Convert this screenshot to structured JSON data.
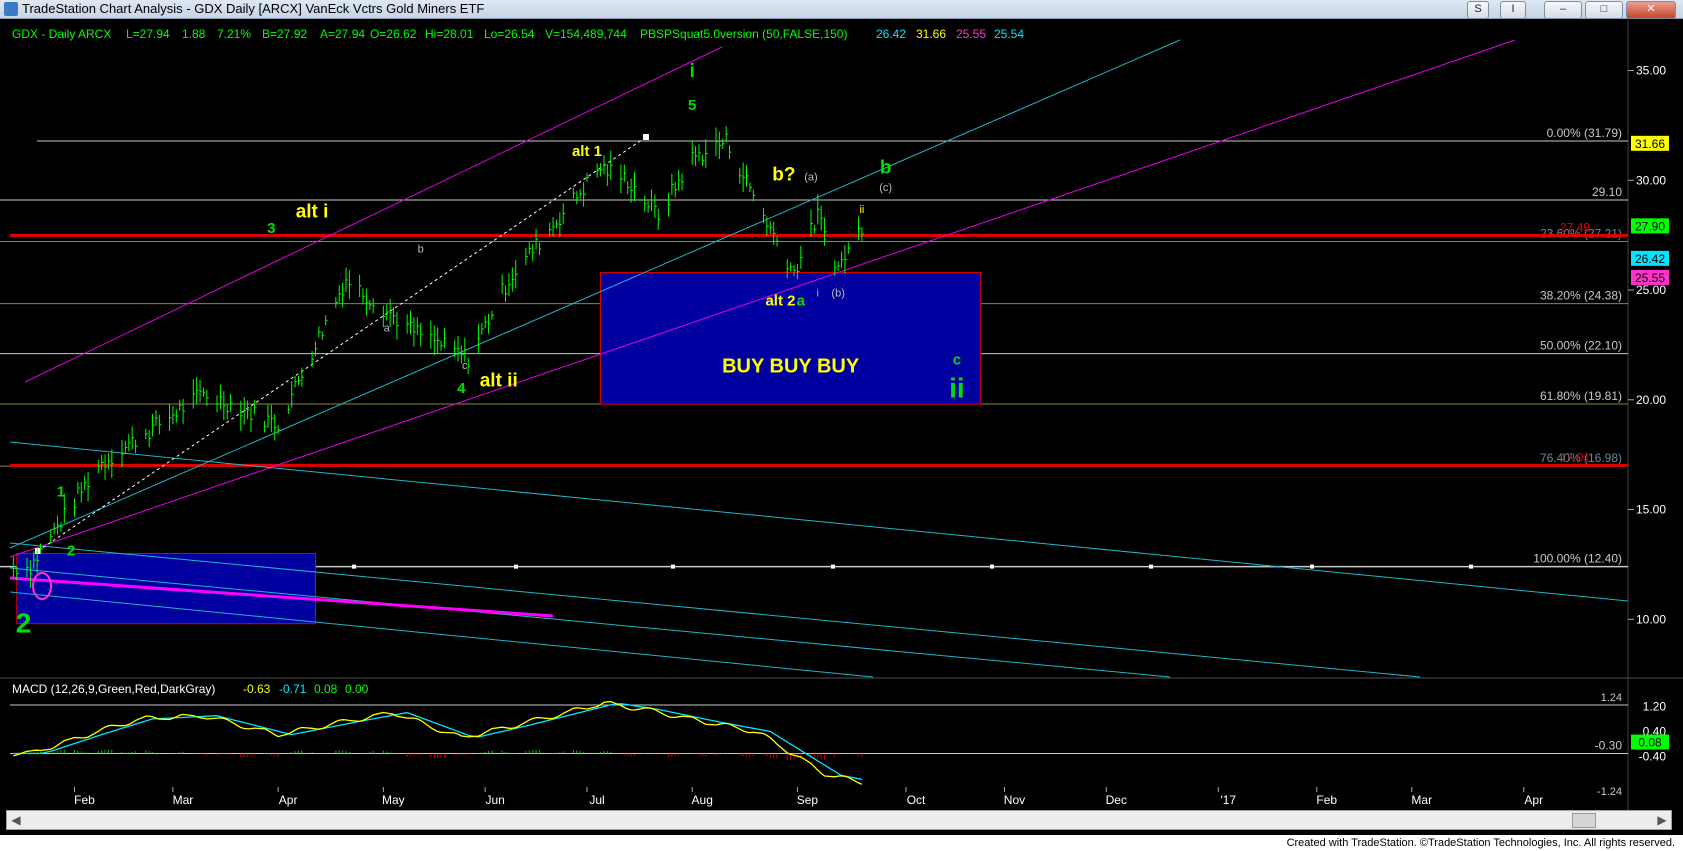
{
  "window": {
    "title": "TradeStation Chart Analysis - GDX Daily [ARCX] VanEck Vctrs Gold Miners ETF",
    "buttons": [
      "S",
      "I",
      "–",
      "□",
      "✕"
    ]
  },
  "credit": "Created with TradeStation. ©TradeStation Technologies, Inc. All rights reserved.",
  "header": {
    "symbol": "GDX - Daily  ARCX",
    "last": "L=27.94",
    "change": "1.88",
    "change_pct": "7.21%",
    "bid": "B=27.92",
    "ask": "A=27.94",
    "open": "O=26.62",
    "high": "Hi=28.01",
    "low": "Lo=26.54",
    "volume": "V=154,489,744",
    "study": "PBSPSquat5.0version (50,FALSE,150)",
    "study_values": [
      "26.42",
      "31.66",
      "25.55",
      "25.54"
    ],
    "study_colors": [
      "#00e5ff",
      "#ffff00",
      "#ff33cc",
      "#00e5ff"
    ]
  },
  "macd_header": {
    "label": "MACD (12,26,9,Green,Red,DarkGray)",
    "values": [
      "-0.63",
      "-0.71",
      "0.08",
      "0.00"
    ],
    "colors": [
      "#ffff00",
      "#00e5ff",
      "#00ff00",
      "#00ff00"
    ]
  },
  "colors": {
    "background": "#000000",
    "price_bars": "#00ff00",
    "channel_magenta": "#e000e0",
    "channel_cyan": "#1fb5c9",
    "resistance_red": "#e00000",
    "buy_box": "#0000a0",
    "fib_line": "#c0c0c0",
    "wave_green": "#00dd00",
    "wave_yellow": "#ffff00"
  },
  "chart_data": [
    {
      "type": "line",
      "title": "GDX - Daily ARCX",
      "xlabel": "",
      "ylabel": "",
      "x_ticks": [
        "Feb",
        "Mar",
        "Apr",
        "May",
        "Jun",
        "Jul",
        "Aug",
        "Sep",
        "Oct",
        "Nov",
        "Dec",
        "'17",
        "Feb",
        "Mar",
        "Apr"
      ],
      "y_ticks": [
        "10.00",
        "15.00",
        "20.00",
        "25.00",
        "30.00",
        "35.00"
      ],
      "ylim": [
        7.6,
        37.3
      ],
      "price_anchors": {
        "x": [
          "2016-01-19",
          "2016-02-08",
          "2016-03-10",
          "2016-04-01",
          "2016-04-21",
          "2016-05-10",
          "2016-05-27",
          "2016-06-08",
          "2016-07-05",
          "2016-07-13",
          "2016-07-22",
          "2016-08-01",
          "2016-08-11",
          "2016-08-24",
          "2016-08-31",
          "2016-09-07",
          "2016-09-13",
          "2016-09-20"
        ],
        "y": [
          12.4,
          17.0,
          20.3,
          18.9,
          25.5,
          23.2,
          21.9,
          25.5,
          30.6,
          30.0,
          28.4,
          31.0,
          31.79,
          27.8,
          25.8,
          28.4,
          26.0,
          27.94
        ]
      },
      "fib_levels": [
        {
          "label": "0.00% (31.79)",
          "value": 31.79
        },
        {
          "label": "29.10",
          "value": 29.1
        },
        {
          "label": "23.60% (27.21)",
          "value": 27.21
        },
        {
          "label": "38.20% (24.38)",
          "value": 24.38
        },
        {
          "label": "50.00% (22.10)",
          "value": 22.1
        },
        {
          "label": "61.80% (19.81)",
          "value": 19.81
        },
        {
          "label": "76.40% (16.98)",
          "value": 16.98
        },
        {
          "label": "100.00% (12.40)",
          "value": 12.4
        }
      ],
      "red_levels": [
        {
          "label": "27.49",
          "value": 27.49
        },
        {
          "label": "17.01",
          "value": 17.01
        }
      ],
      "price_badges": [
        {
          "label": "31.66",
          "value": 31.66,
          "color": "#ffff00"
        },
        {
          "label": "27.90",
          "value": 27.9,
          "color": "#00ff00"
        },
        {
          "label": "26.42",
          "value": 26.42,
          "color": "#00e5ff"
        },
        {
          "label": "25.55",
          "value": 25.55,
          "color": "#ff33cc"
        }
      ],
      "buy_box": {
        "label": "BUY  BUY  BUY",
        "x": [
          "2016-07-05",
          "2016-10-25"
        ],
        "y": [
          19.8,
          25.8
        ]
      },
      "wave_labels": [
        {
          "text": "i",
          "color": "#00dd00",
          "x": "2016-08-01",
          "y": 34.7,
          "size": "large"
        },
        {
          "text": "5",
          "color": "#00dd00",
          "x": "2016-08-01",
          "y": 33.2,
          "size": "medium"
        },
        {
          "text": "alt 1",
          "color": "#ffff00",
          "x": "2016-07-01",
          "y": 31.1,
          "size": "medium"
        },
        {
          "text": "b?",
          "color": "#ffff00",
          "x": "2016-08-28",
          "y": 30.0,
          "size": "large"
        },
        {
          "text": "(a)",
          "color": "#bbbbbb",
          "x": "2016-09-05",
          "y": 30.0,
          "size": "small"
        },
        {
          "text": "b",
          "color": "#00dd00",
          "x": "2016-09-27",
          "y": 30.3,
          "size": "large"
        },
        {
          "text": "(c)",
          "color": "#bbbbbb",
          "x": "2016-09-27",
          "y": 29.5,
          "size": "small"
        },
        {
          "text": "ii",
          "color": "#ffff00",
          "x": "2016-09-20",
          "y": 28.5,
          "size": "small"
        },
        {
          "text": "alt i",
          "color": "#ffff00",
          "x": "2016-04-11",
          "y": 28.3,
          "size": "large"
        },
        {
          "text": "3",
          "color": "#00dd00",
          "x": "2016-03-30",
          "y": 27.6,
          "size": "medium"
        },
        {
          "text": "b",
          "color": "#bbbbbb",
          "x": "2016-05-13",
          "y": 26.7,
          "size": "small"
        },
        {
          "text": "a",
          "color": "#bbbbbb",
          "x": "2016-05-03",
          "y": 23.1,
          "size": "small"
        },
        {
          "text": "c",
          "color": "#bbbbbb",
          "x": "2016-05-26",
          "y": 21.4,
          "size": "small"
        },
        {
          "text": "4",
          "color": "#00dd00",
          "x": "2016-05-25",
          "y": 20.3,
          "size": "medium"
        },
        {
          "text": "alt ii",
          "color": "#ffff00",
          "x": "2016-06-05",
          "y": 20.6,
          "size": "large"
        },
        {
          "text": "alt 2",
          "color": "#ffff00",
          "x": "2016-08-27",
          "y": 24.3,
          "size": "medium"
        },
        {
          "text": "a",
          "color": "#00dd00",
          "x": "2016-09-02",
          "y": 24.3,
          "size": "medium"
        },
        {
          "text": "i",
          "color": "#bbbbbb",
          "x": "2016-09-07",
          "y": 24.7,
          "size": "small"
        },
        {
          "text": "(b)",
          "color": "#bbbbbb",
          "x": "2016-09-13",
          "y": 24.7,
          "size": "small"
        },
        {
          "text": "c",
          "color": "#00dd00",
          "x": "2016-10-18",
          "y": 21.6,
          "size": "medium"
        },
        {
          "text": "ii",
          "color": "#00dd00",
          "x": "2016-10-18",
          "y": 20.1,
          "size": "xlarge"
        },
        {
          "text": "1",
          "color": "#00dd00",
          "x": "2016-01-28",
          "y": 15.6,
          "size": "medium"
        },
        {
          "text": "2",
          "color": "#00dd00",
          "x": "2016-01-31",
          "y": 12.9,
          "size": "medium"
        },
        {
          "text": "2",
          "color": "#00dd00",
          "x": "2016-01-17",
          "y": 9.4,
          "size": "xlarge"
        }
      ],
      "lower_box": {
        "x": [
          "2016-01-15",
          "2016-04-12"
        ],
        "y": [
          9.8,
          13.0
        ]
      }
    },
    {
      "type": "line",
      "title": "MACD (12,26,9,Green,Red,DarkGray)",
      "xlabel": "",
      "ylabel": "",
      "y_ticks": [
        "-0.40",
        "0.40",
        "1.20"
      ],
      "ylim": [
        -1.3,
        1.4
      ],
      "reference_labels": [
        "1.24",
        "-1.24",
        "-0.30"
      ],
      "badge": {
        "label": "0.08",
        "value": 0.08
      },
      "macd_anchors": {
        "x": [
          "2016-01-19",
          "2016-02-05",
          "2016-02-20",
          "2016-03-10",
          "2016-04-01",
          "2016-04-20",
          "2016-05-05",
          "2016-05-25",
          "2016-06-10",
          "2016-07-06",
          "2016-07-18",
          "2016-08-05",
          "2016-08-20",
          "2016-09-01",
          "2016-09-10",
          "2016-09-20"
        ],
        "y": [
          -0.3,
          0.3,
          0.8,
          0.9,
          0.3,
          0.7,
          1.0,
          0.2,
          0.6,
          1.3,
          1.1,
          0.7,
          0.4,
          -0.4,
          -1.0,
          -1.2
        ]
      }
    }
  ]
}
